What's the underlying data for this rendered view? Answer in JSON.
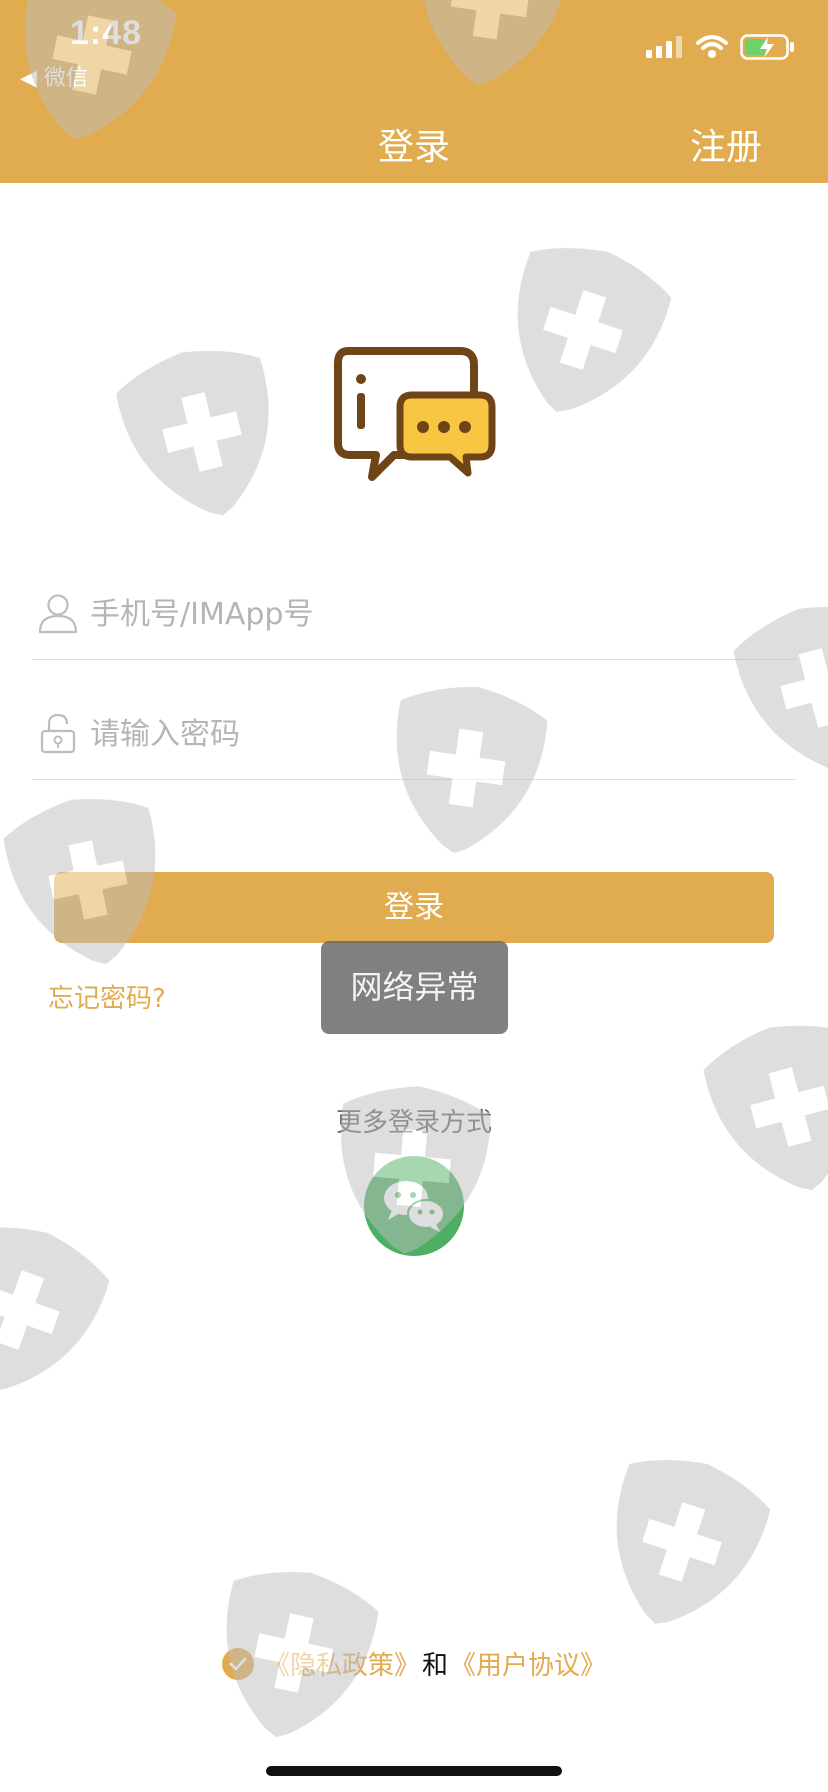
{
  "status_bar": {
    "time": "1:48",
    "back_app": "◀ 微信"
  },
  "nav": {
    "title": "登录",
    "register": "注册"
  },
  "form": {
    "phone_placeholder": "手机号/IMApp号",
    "password_placeholder": "请输入密码",
    "login_label": "登录",
    "forgot_label": "忘记密码?"
  },
  "toast": {
    "message": "网络异常"
  },
  "more_login": {
    "label": "更多登录方式"
  },
  "agreement": {
    "privacy": "《隐私政策》",
    "and": "和",
    "terms": "《用户协议》",
    "checked": true
  },
  "colors": {
    "accent": "#e1ab4f",
    "wechat": "#4caf63"
  },
  "icons": [
    "signal-icon",
    "wifi-icon",
    "battery-icon",
    "user-icon",
    "lock-icon",
    "wechat-icon",
    "check-icon",
    "chat-logo-icon"
  ]
}
